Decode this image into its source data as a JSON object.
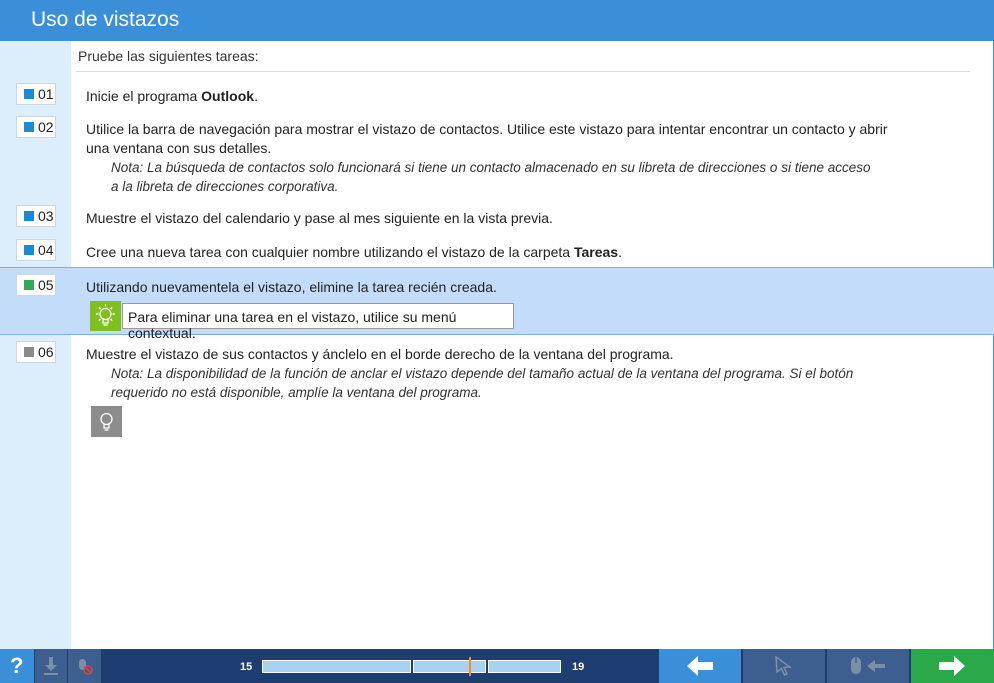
{
  "window": {
    "title": "Uso de vistazos"
  },
  "intro": "Pruebe las siguientes tareas:",
  "tasks": [
    {
      "num": "01",
      "text_before": "Inicie el programa ",
      "bold": "Outlook",
      "text_after": "."
    },
    {
      "num": "02",
      "line1": "Utilice la barra de navegación para mostrar el vistazo de contactos. Utilice este vistazo para intentar encontrar un contacto y abrir",
      "line2": "una ventana con sus detalles.",
      "note1": "Nota: La búsqueda de contactos solo funcionará si tiene un contacto almacenado en su libreta de direcciones o si tiene acceso",
      "note2": "a la libreta de direcciones corporativa."
    },
    {
      "num": "03",
      "text": "Muestre el vistazo del calendario y pase al mes siguiente en la vista previa."
    },
    {
      "num": "04",
      "text_before": "Cree una nueva tarea con cualquier nombre utilizando el vistazo de la carpeta ",
      "bold": "Tareas",
      "text_after": "."
    },
    {
      "num": "05",
      "text": "Utilizando nuevamentela el vistazo, elimine la tarea recién creada.",
      "hint": "Para eliminar una tarea en el vistazo, utilice su menú contextual."
    },
    {
      "num": "06",
      "text": "Muestre el vistazo de sus contactos y ánclelo en el borde derecho de la ventana del programa.",
      "note1": "Nota: La disponibilidad de la función de anclar el vistazo depende del tamaño actual de la ventana del programa. Si el botón",
      "note2": "requerido no está disponible, amplíe la ventana del programa."
    }
  ],
  "bottombar": {
    "help_label": "?",
    "progress": {
      "start": "15",
      "end": "19",
      "position": 0.5
    },
    "icons": [
      "download-icon",
      "no-mouse-icon",
      "back-arrow-icon",
      "cursor-icon",
      "mouse-arrow-icon",
      "next-arrow-icon"
    ]
  },
  "colors": {
    "title_bar": "#3a8fd8",
    "left_panel": "#dceefc",
    "active_row": "#c3dcf9",
    "bottom_bar": "#1e3e72",
    "next_button": "#2aa84a",
    "hint_icon": "#7fbf1f"
  }
}
